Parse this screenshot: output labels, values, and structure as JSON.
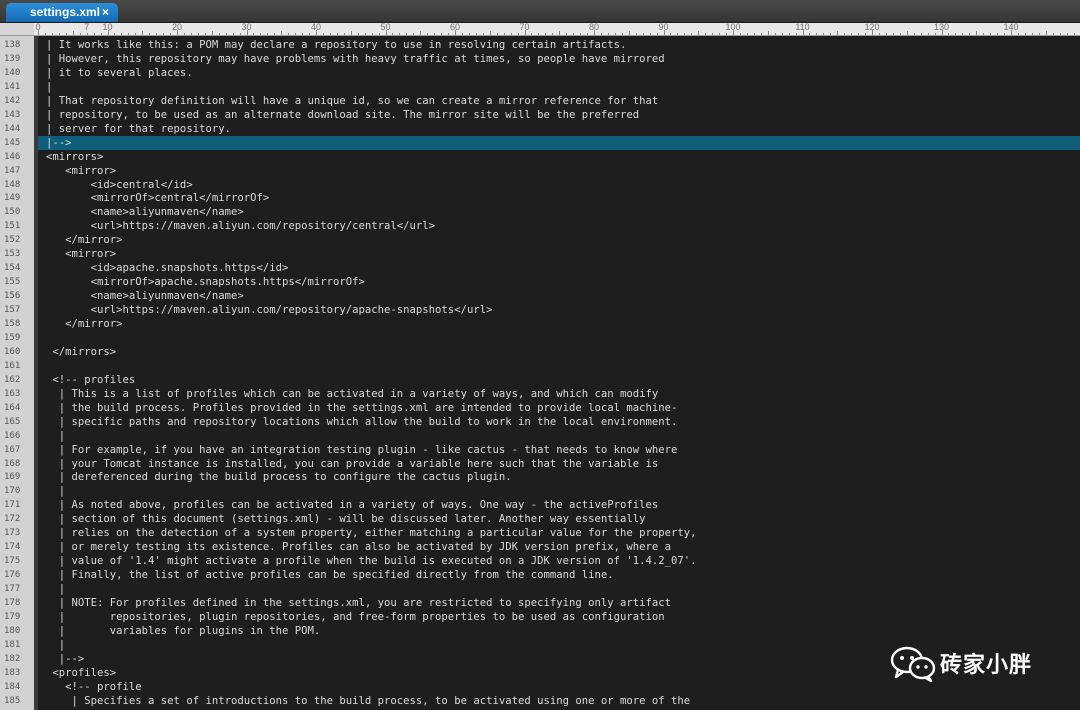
{
  "tab": {
    "title": "settings.xml",
    "close": "×"
  },
  "ruler": {
    "labels": [
      "0",
      "10",
      "20",
      "30",
      "40",
      "50",
      "60",
      "70",
      "80",
      "90",
      "100",
      "110",
      "120",
      "130",
      "140"
    ],
    "partial_label": "7"
  },
  "editor": {
    "first_line": 138,
    "highlight_line": 145,
    "lines": [
      "| It works like this: a POM may declare a repository to use in resolving certain artifacts.",
      "| However, this repository may have problems with heavy traffic at times, so people have mirrored",
      "| it to several places.",
      "|",
      "| That repository definition will have a unique id, so we can create a mirror reference for that",
      "| repository, to be used as an alternate download site. The mirror site will be the preferred",
      "| server for that repository.",
      "|-->",
      "<mirrors>",
      "   <mirror>",
      "       <id>central</id>",
      "       <mirrorOf>central</mirrorOf>",
      "       <name>aliyunmaven</name>",
      "       <url>https://maven.aliyun.com/repository/central</url>",
      "   </mirror>",
      "   <mirror>",
      "       <id>apache.snapshots.https</id>",
      "       <mirrorOf>apache.snapshots.https</mirrorOf>",
      "       <name>aliyunmaven</name>",
      "       <url>https://maven.aliyun.com/repository/apache-snapshots</url>",
      "   </mirror>",
      "",
      " </mirrors>",
      "",
      " <!-- profiles",
      "  | This is a list of profiles which can be activated in a variety of ways, and which can modify",
      "  | the build process. Profiles provided in the settings.xml are intended to provide local machine-",
      "  | specific paths and repository locations which allow the build to work in the local environment.",
      "  |",
      "  | For example, if you have an integration testing plugin - like cactus - that needs to know where",
      "  | your Tomcat instance is installed, you can provide a variable here such that the variable is",
      "  | dereferenced during the build process to configure the cactus plugin.",
      "  |",
      "  | As noted above, profiles can be activated in a variety of ways. One way - the activeProfiles",
      "  | section of this document (settings.xml) - will be discussed later. Another way essentially",
      "  | relies on the detection of a system property, either matching a particular value for the property,",
      "  | or merely testing its existence. Profiles can also be activated by JDK version prefix, where a",
      "  | value of '1.4' might activate a profile when the build is executed on a JDK version of '1.4.2_07'.",
      "  | Finally, the list of active profiles can be specified directly from the command line.",
      "  |",
      "  | NOTE: For profiles defined in the settings.xml, you are restricted to specifying only artifact",
      "  |       repositories, plugin repositories, and free-form properties to be used as configuration",
      "  |       variables for plugins in the POM.",
      "  |",
      "  |-->",
      " <profiles>",
      "   <!-- profile",
      "    | Specifies a set of introductions to the build process, to be activated using one or more of the"
    ]
  },
  "watermark": {
    "text": "砖家小胖",
    "icon": "wechat-icon"
  }
}
